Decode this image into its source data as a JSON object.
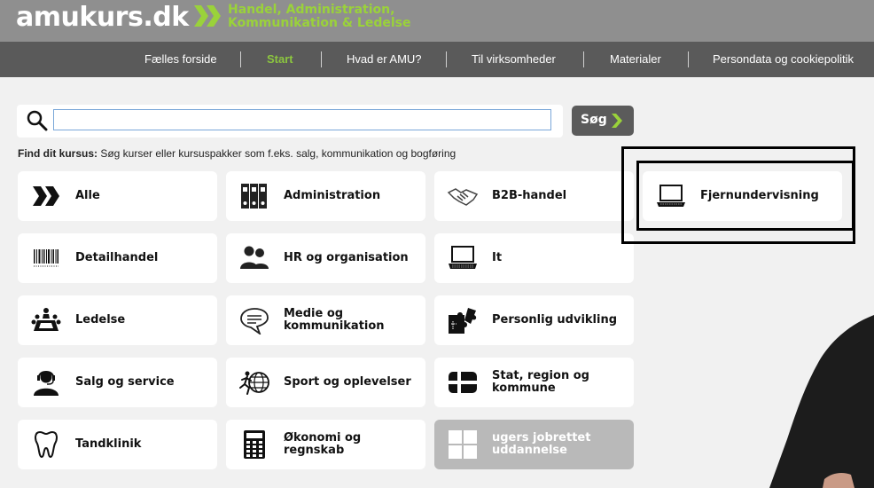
{
  "header": {
    "logo_text": "amukurs.dk",
    "tagline_line1": "Handel, Administration,",
    "tagline_line2": "Kommunikation & Ledelse",
    "accent_color": "#8cc63f"
  },
  "nav": {
    "items": [
      {
        "label": "Fælles forside",
        "active": false
      },
      {
        "label": "Start",
        "active": true
      },
      {
        "label": "Hvad er AMU?",
        "active": false
      },
      {
        "label": "Til virksomheder",
        "active": false
      },
      {
        "label": "Materialer",
        "active": false
      },
      {
        "label": "Persondata og cookiepolitik",
        "active": false
      }
    ]
  },
  "search": {
    "value": "",
    "button_label": "Søg",
    "hint_label": "Find dit kursus:",
    "hint_text": "Søg kurser eller kursuspakker som f.eks. salg, kommunikation og bogføring"
  },
  "categories": [
    {
      "label": "Alle",
      "icon": "double-chevron-icon"
    },
    {
      "label": "Administration",
      "icon": "binders-icon"
    },
    {
      "label": "B2B-handel",
      "icon": "handshake-icon"
    },
    {
      "label": "Fjernundervisning",
      "icon": "laptop-icon"
    },
    {
      "label": "Detailhandel",
      "icon": "barcode-icon"
    },
    {
      "label": "HR og organisation",
      "icon": "people-icon"
    },
    {
      "label": "It",
      "icon": "laptop-icon"
    },
    {
      "label": "Ledelse",
      "icon": "meeting-icon"
    },
    {
      "label": "Medie og kommunikation",
      "icon": "speech-bubble-icon"
    },
    {
      "label": "Personlig udvikling",
      "icon": "puzzle-icon"
    },
    {
      "label": "Salg og service",
      "icon": "headset-person-icon"
    },
    {
      "label": "Sport og oplevelser",
      "icon": "runner-globe-icon"
    },
    {
      "label": "Stat, region og kommune",
      "icon": "flag-icon"
    },
    {
      "label": "Tandklinik",
      "icon": "tooth-icon"
    },
    {
      "label": "Økonomi og regnskab",
      "icon": "calculator-icon"
    },
    {
      "label": "ugers jobrettet uddannelse",
      "icon": "grid-icon"
    }
  ]
}
